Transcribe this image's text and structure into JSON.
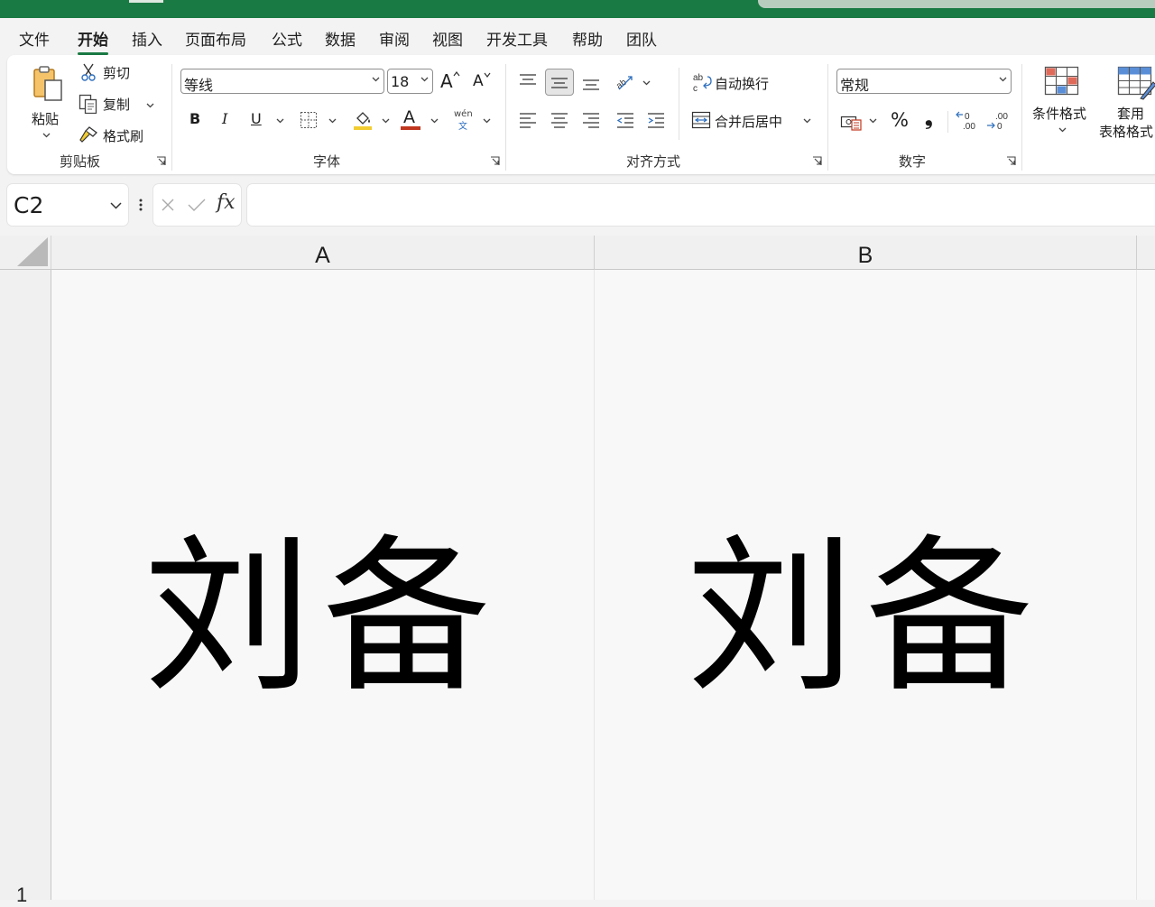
{
  "menu": {
    "items": [
      "文件",
      "开始",
      "插入",
      "页面布局",
      "公式",
      "数据",
      "审阅",
      "视图",
      "开发工具",
      "帮助",
      "团队"
    ],
    "active": "开始"
  },
  "ribbon": {
    "clipboard": {
      "paste_label": "粘贴",
      "cut_label": "剪切",
      "copy_label": "复制",
      "format_painter_label": "格式刷",
      "group_label": "剪贴板"
    },
    "font": {
      "font_name": "等线",
      "font_size": "18",
      "bold_label": "B",
      "italic_label": "I",
      "underline_label": "U",
      "grow_label": "A",
      "shrink_label": "A",
      "font_color_label": "A",
      "phonetic_top": "wén",
      "phonetic_bottom": "文",
      "group_label": "字体",
      "fill_color": "#f2cd32",
      "font_color": "#c0371f"
    },
    "alignment": {
      "wrap_text_label": "自动换行",
      "merge_center_label": "合并后居中",
      "group_label": "对齐方式"
    },
    "number": {
      "format_value": "常规",
      "percent_label": "%",
      "comma_label": "❟",
      "group_label": "数字"
    },
    "styles": {
      "conditional_label": "条件格式",
      "table_label_line1": "套用",
      "table_label_line2": "表格格式"
    }
  },
  "formula_bar": {
    "name_box": "C2",
    "fx_label": "fx",
    "formula_value": ""
  },
  "sheet": {
    "columns": [
      "A",
      "B"
    ],
    "row_number": "1",
    "cells": [
      {
        "ref": "A1",
        "value": "刘备"
      },
      {
        "ref": "B1",
        "value": "刘备"
      }
    ]
  },
  "colors": {
    "brand": "#1a7a43"
  }
}
